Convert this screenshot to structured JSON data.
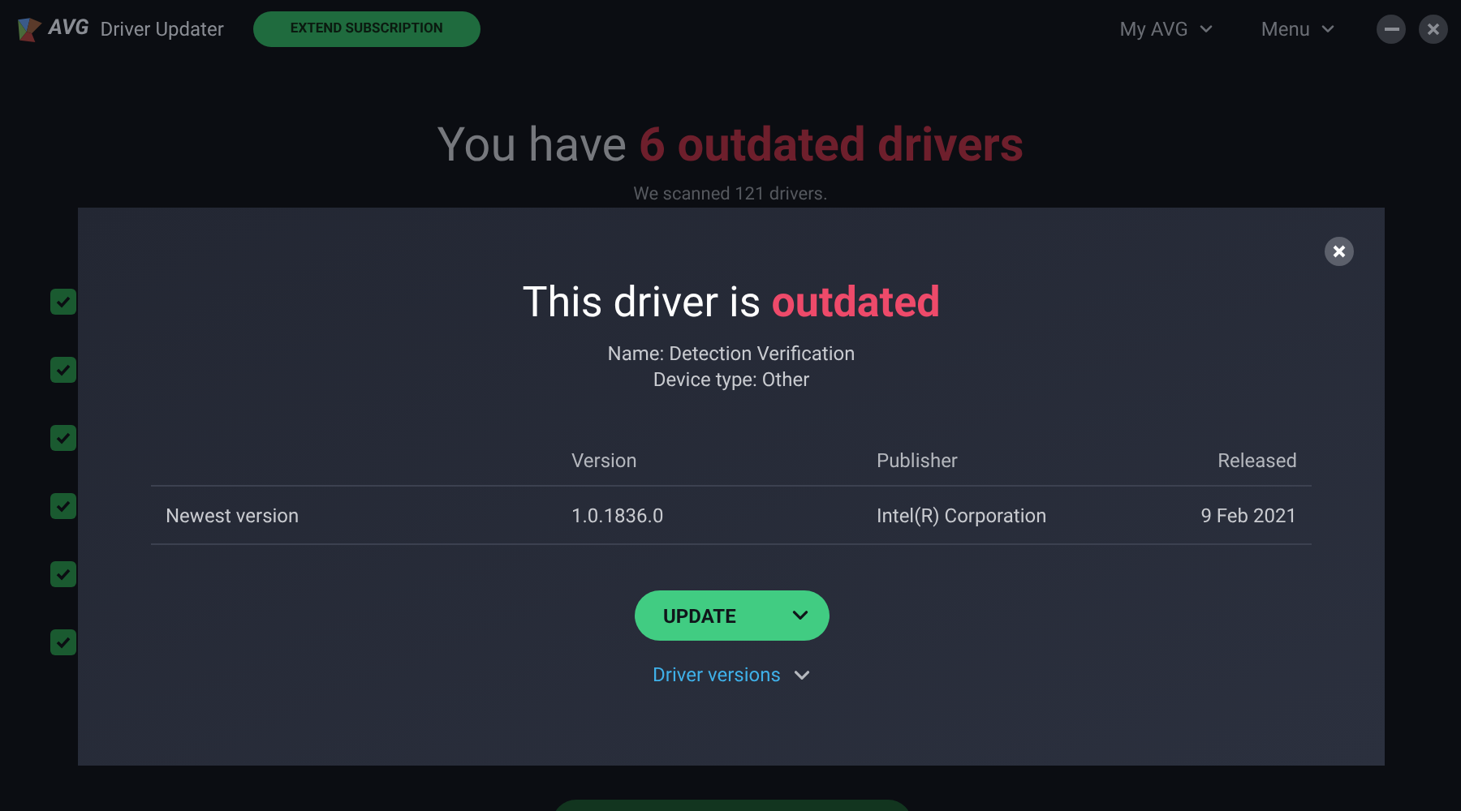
{
  "app": {
    "logo_text": "AVG",
    "title": "Driver Updater",
    "subscription_button": "EXTEND SUBSCRIPTION",
    "menus": [
      "My AVG",
      "Menu"
    ]
  },
  "summary": {
    "headline": "You have ",
    "headline_highlight": "6 outdated drivers",
    "subtitle": "We scanned 121 drivers."
  },
  "driver_checkboxes": [
    {
      "checked": true
    },
    {
      "checked": true
    },
    {
      "checked": true
    },
    {
      "checked": true
    },
    {
      "checked": true
    },
    {
      "checked": true
    }
  ],
  "dialog": {
    "title": "This driver is ",
    "title_highlight": "outdated",
    "name_line": "Name: Detection Verification",
    "device_type_line": "Device type: Other",
    "table": {
      "columns": [
        "Version",
        "Publisher",
        "Released"
      ],
      "rows": [
        {
          "label": "Newest version",
          "cells": [
            "1.0.1836.0",
            "Intel(R) Corporation",
            "9 Feb 2021"
          ]
        }
      ]
    },
    "update_button": "UPDATE",
    "versions_link": "Driver versions"
  }
}
